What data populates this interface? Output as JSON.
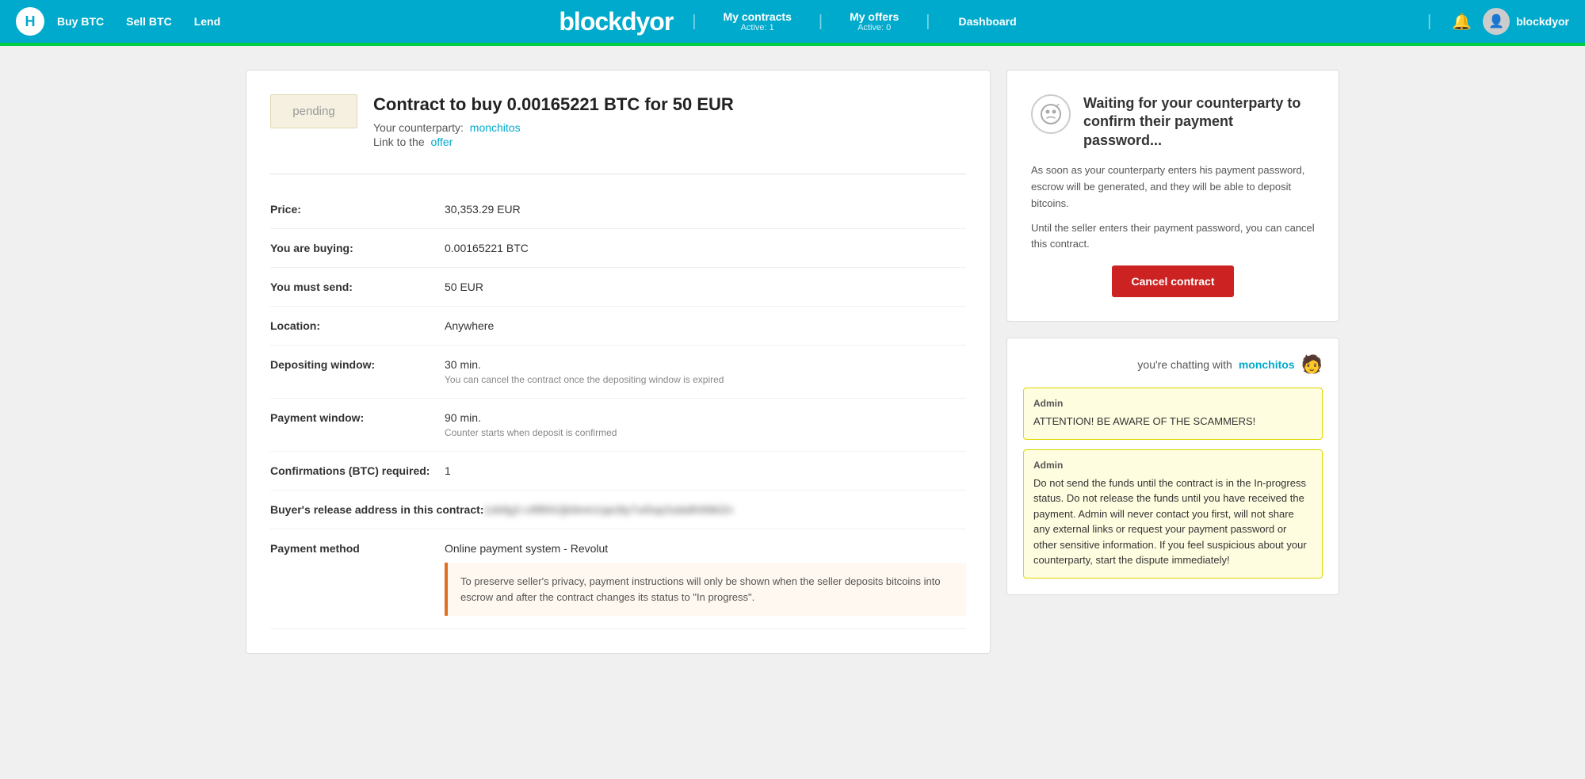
{
  "navbar": {
    "logo_text": "blockdyor",
    "logo_icon": "H",
    "buy_btc": "Buy BTC",
    "sell_btc": "Sell BTC",
    "lend": "Lend",
    "my_contracts": "My contracts",
    "my_contracts_active": "Active: 1",
    "my_offers": "My offers",
    "my_offers_active": "Active: 0",
    "dashboard": "Dashboard",
    "username": "blockdyor",
    "divider": "|"
  },
  "contract": {
    "status": "pending",
    "title": "Contract to buy 0.00165221 BTC for 50 EUR",
    "counterparty_label": "Your counterparty:",
    "counterparty_name": "monchitos",
    "offer_label": "Link to the",
    "offer_link": "offer",
    "price_label": "Price:",
    "price_value": "30,353.29 EUR",
    "buying_label": "You are buying:",
    "buying_value": "0.00165221 BTC",
    "send_label": "You must send:",
    "send_value": "50 EUR",
    "location_label": "Location:",
    "location_value": "Anywhere",
    "depositing_label": "Depositing window:",
    "depositing_value": "30 min.",
    "depositing_sub": "You can cancel the contract once the depositing window is expired",
    "payment_window_label": "Payment window:",
    "payment_window_value": "90 min.",
    "payment_window_sub": "Counter starts when deposit is confirmed",
    "confirmations_label": "Confirmations (BTC) required:",
    "confirmations_value": "1",
    "release_address_label": "Buyer's release address in this contract:",
    "release_address_blurred": "1xb9g3 c4f8hh2jk9mm1 qw3ty7ui0op2sd",
    "payment_method_label": "Payment method",
    "payment_method_value": "Online payment system - Revolut",
    "privacy_notice": "To preserve seller's privacy, payment instructions will only be shown when the seller deposits bitcoins into escrow and after the contract changes its status to \"In progress\"."
  },
  "waiting": {
    "title": "Waiting for your counterparty to confirm their payment password...",
    "desc1": "As soon as your counterparty enters his payment password, escrow will be generated, and they will be able to deposit bitcoins.",
    "desc2": "Until the seller enters their payment password, you can cancel this contract.",
    "cancel_btn": "Cancel contract"
  },
  "chat": {
    "chatting_with_label": "you're chatting with",
    "counterparty": "monchitos",
    "messages": [
      {
        "sender": "Admin",
        "text": "ATTENTION! BE AWARE OF THE SCAMMERS!"
      },
      {
        "sender": "Admin",
        "text": "Do not send the funds until the contract is in the In-progress status. Do not release the funds until you have received the payment. Admin will never contact you first, will not share any external links or request your payment password or other sensitive information. If you feel suspicious about your counterparty, start the dispute immediately!"
      }
    ]
  }
}
